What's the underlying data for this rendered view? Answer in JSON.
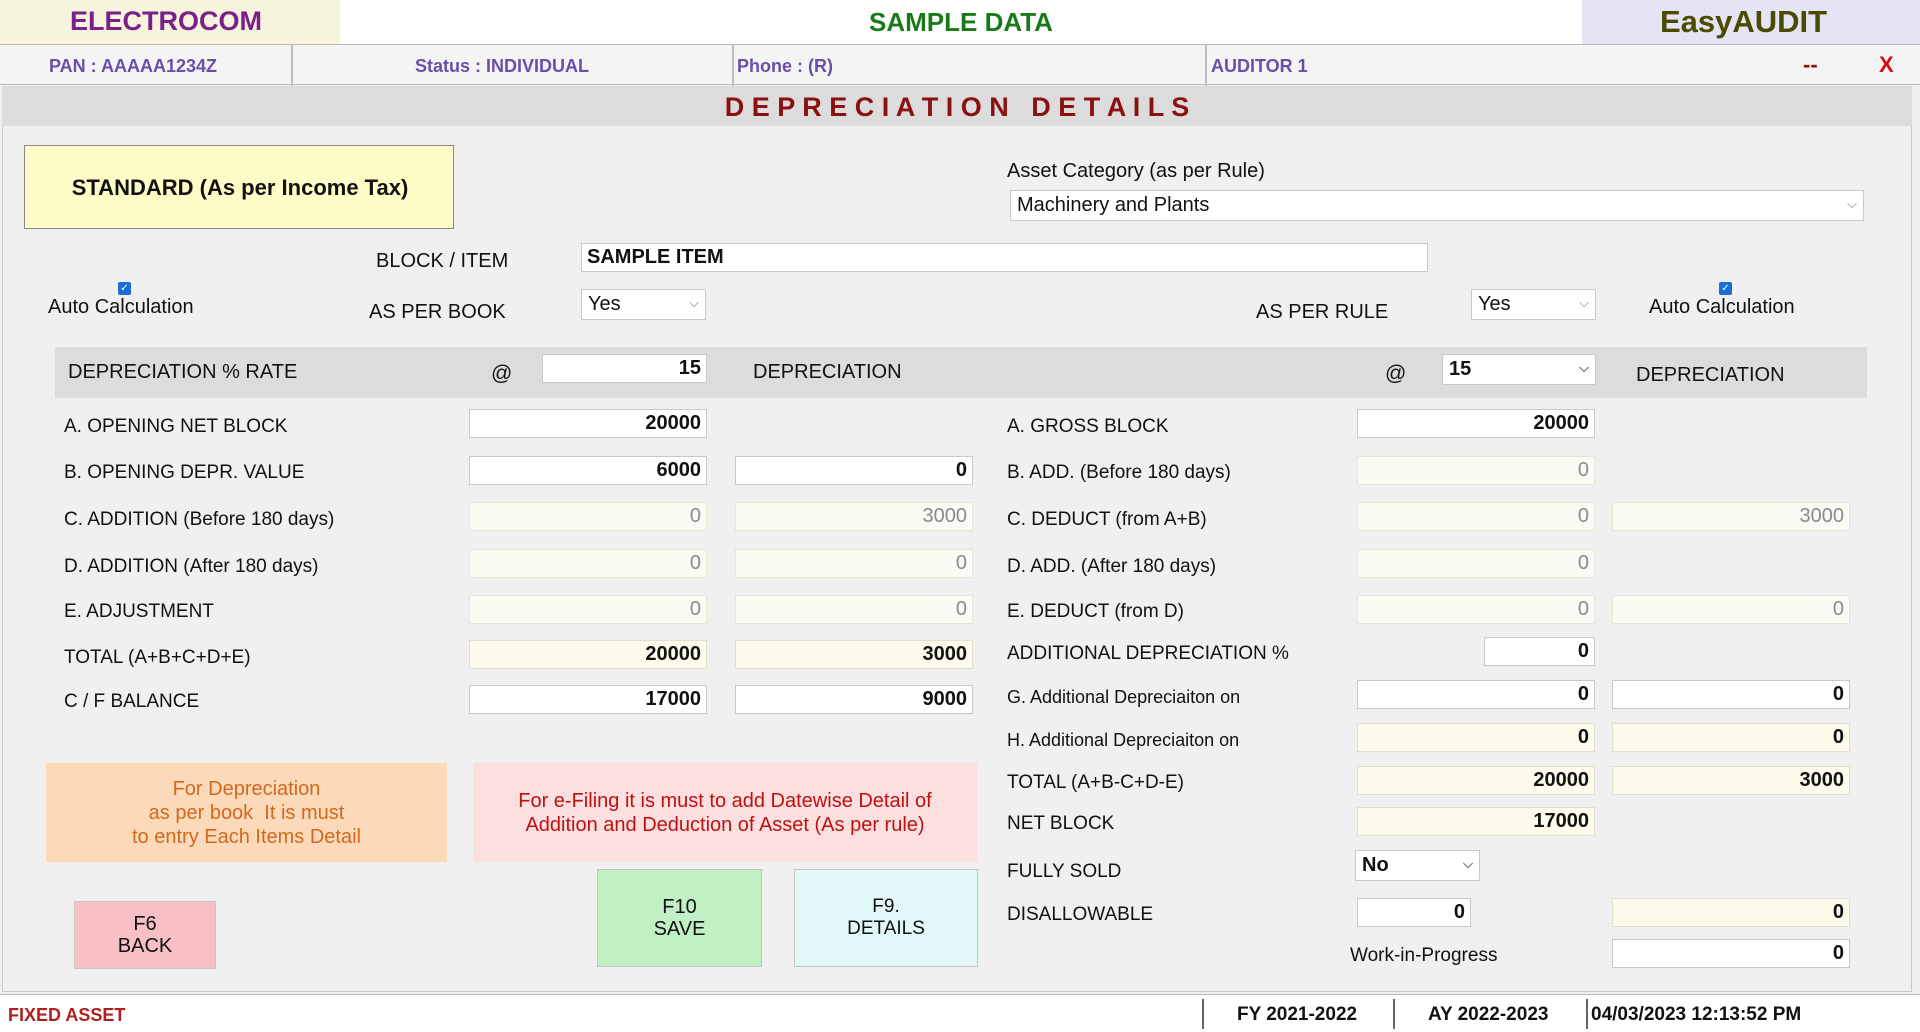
{
  "header": {
    "company": "ELECTROCOM",
    "data_title": "SAMPLE DATA",
    "app_name": "EasyAUDIT"
  },
  "info_bar": {
    "pan": "PAN  :  AAAAA1234Z",
    "status": "Status  :  INDIVIDUAL",
    "phone": "Phone  : (R)",
    "auditor": "AUDITOR 1",
    "minimize": "--",
    "close": "X"
  },
  "page_title": "D E P R E C I A T I O N   D E T A I L S",
  "standard_label": "STANDARD (As per Income Tax)",
  "asset_category": {
    "label": "Asset Category (as per Rule)",
    "value": "Machinery and Plants"
  },
  "block_item": {
    "label": "BLOCK / ITEM",
    "value": "SAMPLE ITEM"
  },
  "auto_calc_left": "Auto Calculation",
  "auto_calc_right": "Auto Calculation",
  "as_per_book": {
    "label": "AS PER BOOK",
    "value": "Yes"
  },
  "as_per_rule": {
    "label": "AS PER RULE",
    "value": "Yes"
  },
  "rate_bar": {
    "label": "DEPRECIATION % RATE",
    "at_left": "@",
    "book_rate": "15",
    "depr_left": "DEPRECIATION",
    "at_right": "@",
    "rule_rate": "15",
    "depr_right": "DEPRECIATION"
  },
  "book_rows": [
    {
      "label": "A.  OPENING NET BLOCK",
      "value": "20000",
      "depr": ""
    },
    {
      "label": "B.  OPENING DEPR. VALUE",
      "value": "6000",
      "depr": "0"
    },
    {
      "label": "C.  ADDITION (Before 180 days)",
      "value": "0",
      "depr": "3000"
    },
    {
      "label": "D.  ADDITION (After 180 days)",
      "value": "0",
      "depr": "0"
    },
    {
      "label": "E.  ADJUSTMENT",
      "value": "0",
      "depr": "0"
    },
    {
      "label": "TOTAL (A+B+C+D+E)",
      "value": "20000",
      "depr": "3000"
    },
    {
      "label": "C / F BALANCE",
      "value": "17000",
      "depr": "9000"
    }
  ],
  "rule_rows": [
    {
      "label": "A.  GROSS BLOCK",
      "value": "20000",
      "depr": ""
    },
    {
      "label": "B.  ADD. (Before 180 days)",
      "value": "0",
      "depr": ""
    },
    {
      "label": "C.  DEDUCT (from A+B)",
      "value": "0",
      "depr": "3000"
    },
    {
      "label": "D.  ADD. (After 180 days)",
      "value": "0",
      "depr": ""
    },
    {
      "label": "E.  DEDUCT (from D)",
      "value": "0",
      "depr": "0"
    },
    {
      "label": "ADDITIONAL DEPRECIATION %",
      "value": "0",
      "depr": ""
    },
    {
      "label": "G. Additional Depreciaiton on",
      "value": "0",
      "depr": "0"
    },
    {
      "label": "H. Additional Depreciaiton on",
      "value": "0",
      "depr": "0"
    },
    {
      "label": "TOTAL (A+B-C+D-E)",
      "value": "20000",
      "depr": "3000"
    },
    {
      "label": "NET BLOCK",
      "value": "17000",
      "depr": ""
    },
    {
      "label": "FULLY SOLD",
      "value": "No",
      "depr": ""
    },
    {
      "label": "DISALLOWABLE",
      "value": "0",
      "depr": "0"
    },
    {
      "label": "Work-in-Progress",
      "value": "",
      "depr": "0"
    }
  ],
  "notes": {
    "book_note": [
      "For Depreciation",
      "as per book  It is must",
      "to entry Each Items Detail"
    ],
    "efiling_note": [
      "For e-Filing it is must to add Datewise Detail of",
      "Addition and Deduction of Asset (As per rule)"
    ]
  },
  "buttons": {
    "back_key": "F6",
    "back_label": "BACK",
    "save_key": "F10",
    "save_label": "SAVE",
    "details_key": "F9.",
    "details_label": "DETAILS"
  },
  "status_bar": {
    "module": "FIXED ASSET",
    "fy": "FY 2021-2022",
    "ay": "AY 2022-2023",
    "datetime": "04/03/2023 12:13:52 PM"
  },
  "colors": {
    "company": "#7a1f8c",
    "title_green": "#1a7a1a",
    "app_name": "#4a4a00",
    "info_text": "#6a4fa8",
    "page_title": "#8b1010",
    "close_x": "#d01010"
  }
}
